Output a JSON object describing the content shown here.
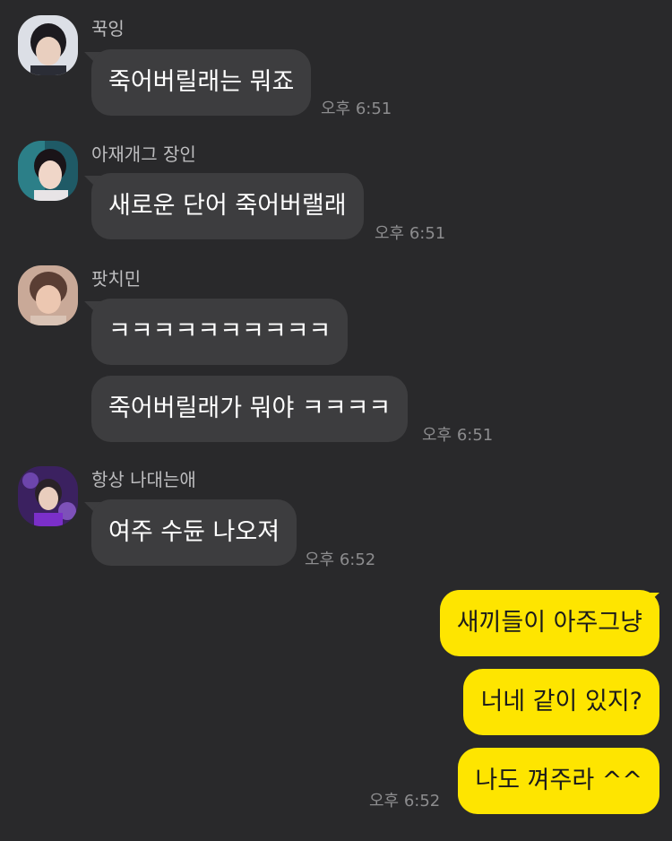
{
  "chat": {
    "groups": [
      {
        "sender": "꾹잉",
        "messages": [
          {
            "text": "죽어버릴래는 뭐죠",
            "time": "오후 6:51"
          }
        ]
      },
      {
        "sender": "아재개그 장인",
        "messages": [
          {
            "text": "새로운 단어 죽어버랠래",
            "time": "오후 6:51"
          }
        ]
      },
      {
        "sender": "팟치민",
        "messages": [
          {
            "text": "ㅋㅋㅋㅋㅋㅋㅋㅋㅋㅋ",
            "time": ""
          },
          {
            "text": "죽어버릴래가 뭐야 ㅋㅋㅋㅋ",
            "time": "오후 6:51"
          }
        ]
      },
      {
        "sender": "항상 나대는애",
        "messages": [
          {
            "text": "여주 수듄 나오져",
            "time": "오후 6:52"
          }
        ]
      }
    ],
    "outgoing": {
      "messages": [
        {
          "text": "새끼들이 아주그냥",
          "time": ""
        },
        {
          "text": "너네 같이 있지?",
          "time": ""
        },
        {
          "text": "나도 껴주라 ^^",
          "time": "오후 6:52"
        }
      ]
    }
  },
  "colors": {
    "background": "#29292b",
    "incoming_bubble": "#3d3d3f",
    "outgoing_bubble": "#fee500"
  }
}
